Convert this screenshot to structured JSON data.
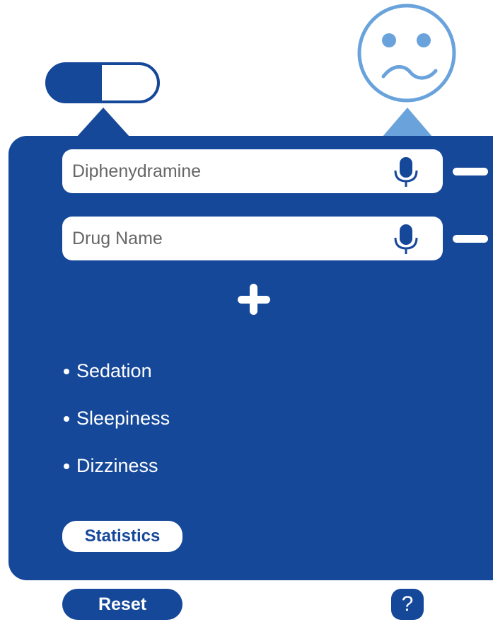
{
  "colors": {
    "primary": "#16489a",
    "accent_light": "#6aa3dc",
    "white": "#ffffff",
    "input_text": "#666666"
  },
  "icons": {
    "toggle": "pill-toggle-icon",
    "face": "sad-face-icon",
    "microphone": "microphone-icon",
    "remove": "minus-icon",
    "add": "plus-icon"
  },
  "drugs": [
    {
      "value": "Diphenydramine",
      "placeholder": ""
    },
    {
      "value": "",
      "placeholder": "Drug Name"
    }
  ],
  "side_effects": [
    "Sedation",
    "Sleepiness",
    "Dizziness"
  ],
  "buttons": {
    "statistics": "Statistics",
    "reset": "Reset",
    "help": "?"
  }
}
